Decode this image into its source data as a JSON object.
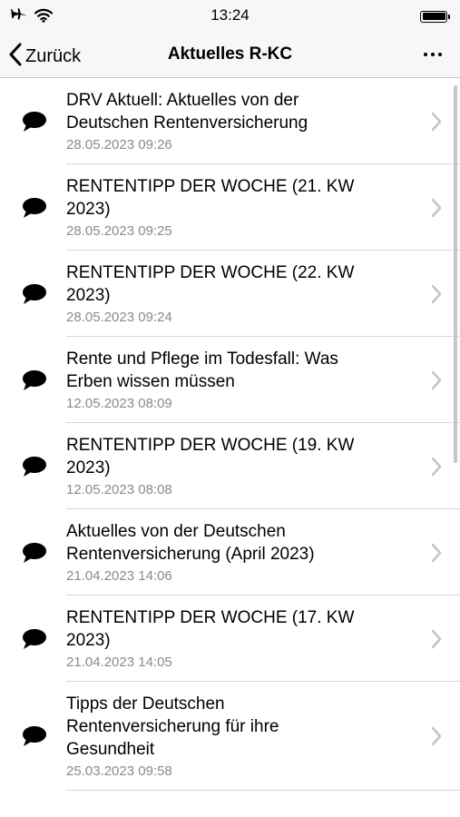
{
  "status_bar": {
    "time": "13:24",
    "icons": [
      "airplane-icon",
      "wifi-icon",
      "battery-icon"
    ]
  },
  "nav": {
    "back_label": "Zurück",
    "title": "Aktuelles R-KC",
    "more_icon": "more-icon"
  },
  "items": [
    {
      "title_line1": "DRV Aktuell: Aktuelles von der",
      "title_line2": "Deutschen Rentenversicherung",
      "title_line3": "",
      "date": "28.05.2023 09:26"
    },
    {
      "title_line1": "RENTENTIPP DER WOCHE (21. KW",
      "title_line2": "2023)",
      "title_line3": "",
      "date": "28.05.2023 09:25"
    },
    {
      "title_line1": "RENTENTIPP DER WOCHE (22. KW",
      "title_line2": "2023)",
      "title_line3": "",
      "date": "28.05.2023 09:24"
    },
    {
      "title_line1": "Rente und Pflege im Todesfall: Was",
      "title_line2": "Erben wissen müssen",
      "title_line3": "",
      "date": "12.05.2023 08:09"
    },
    {
      "title_line1": "RENTENTIPP DER WOCHE (19. KW",
      "title_line2": "2023)",
      "title_line3": "",
      "date": "12.05.2023 08:08"
    },
    {
      "title_line1": "Aktuelles von der Deutschen",
      "title_line2": "Rentenversicherung (April 2023)",
      "title_line3": "",
      "date": "21.04.2023 14:06"
    },
    {
      "title_line1": "RENTENTIPP DER WOCHE (17. KW",
      "title_line2": "2023)",
      "title_line3": "",
      "date": "21.04.2023 14:05"
    },
    {
      "title_line1": "Tipps der Deutschen",
      "title_line2": "Rentenversicherung für ihre",
      "title_line3": "Gesundheit",
      "date": "25.03.2023 09:58"
    }
  ],
  "icons": {
    "item_icon": "speech-bubble-icon",
    "row_arrow": "chevron-right-icon"
  },
  "colors": {
    "bar_background": "#f7f7f7",
    "date_text": "#8a8a8a",
    "separator": "#d6d6d6",
    "chevron": "#c4c4c4"
  }
}
